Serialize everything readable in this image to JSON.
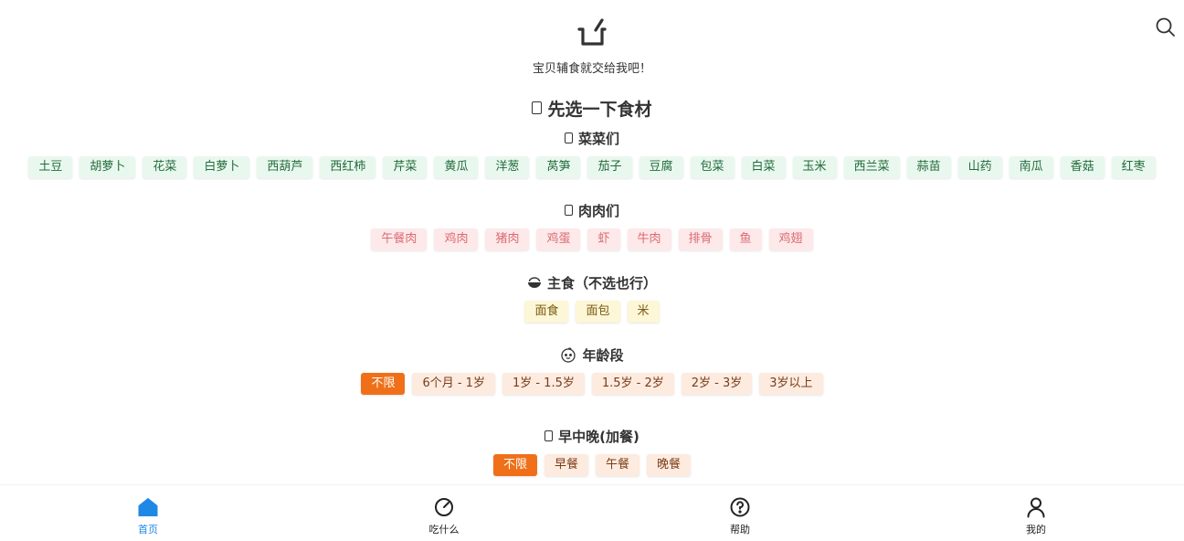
{
  "header": {
    "logo_icon": "pot-icon",
    "search_icon": "search-icon",
    "tagline": "宝贝辅食就交给我吧！"
  },
  "main": {
    "title": "先选一下食材",
    "vegetables": {
      "title": "菜菜们",
      "items": [
        "土豆",
        "胡萝卜",
        "花菜",
        "白萝卜",
        "西葫芦",
        "西红柿",
        "芹菜",
        "黄瓜",
        "洋葱",
        "莴笋",
        "茄子",
        "豆腐",
        "包菜",
        "白菜",
        "玉米",
        "西兰菜",
        "蒜苗",
        "山药",
        "南瓜",
        "香菇",
        "红枣"
      ]
    },
    "meats": {
      "title": "肉肉们",
      "items": [
        "午餐肉",
        "鸡肉",
        "猪肉",
        "鸡蛋",
        "虾",
        "牛肉",
        "排骨",
        "鱼",
        "鸡翅"
      ]
    },
    "staples": {
      "title": "主食（不选也行）",
      "items": [
        "面食",
        "面包",
        "米"
      ]
    },
    "age": {
      "title": "年龄段",
      "items": [
        "不限",
        "6个月 - 1岁",
        "1岁 - 1.5岁",
        "1.5岁 - 2岁",
        "2岁 - 3岁",
        "3岁以上"
      ],
      "selected": "不限"
    },
    "meal": {
      "title": "早中晚(加餐)",
      "items": [
        "不限",
        "早餐",
        "午餐",
        "晚餐"
      ],
      "selected": "不限"
    }
  },
  "nav": {
    "items": [
      {
        "label": "首页",
        "icon": "home-icon",
        "active": true
      },
      {
        "label": "吃什么",
        "icon": "compass-icon",
        "active": false
      },
      {
        "label": "帮助",
        "icon": "help-icon",
        "active": false
      },
      {
        "label": "我的",
        "icon": "user-icon",
        "active": false
      }
    ]
  },
  "colors": {
    "accent": "#f07019",
    "nav_active": "#1e88e5",
    "veg_bg": "#e9f8ee",
    "meat_bg": "#fde9ea",
    "staple_bg": "#fdf6d7",
    "age_bg": "#fdebe0"
  }
}
